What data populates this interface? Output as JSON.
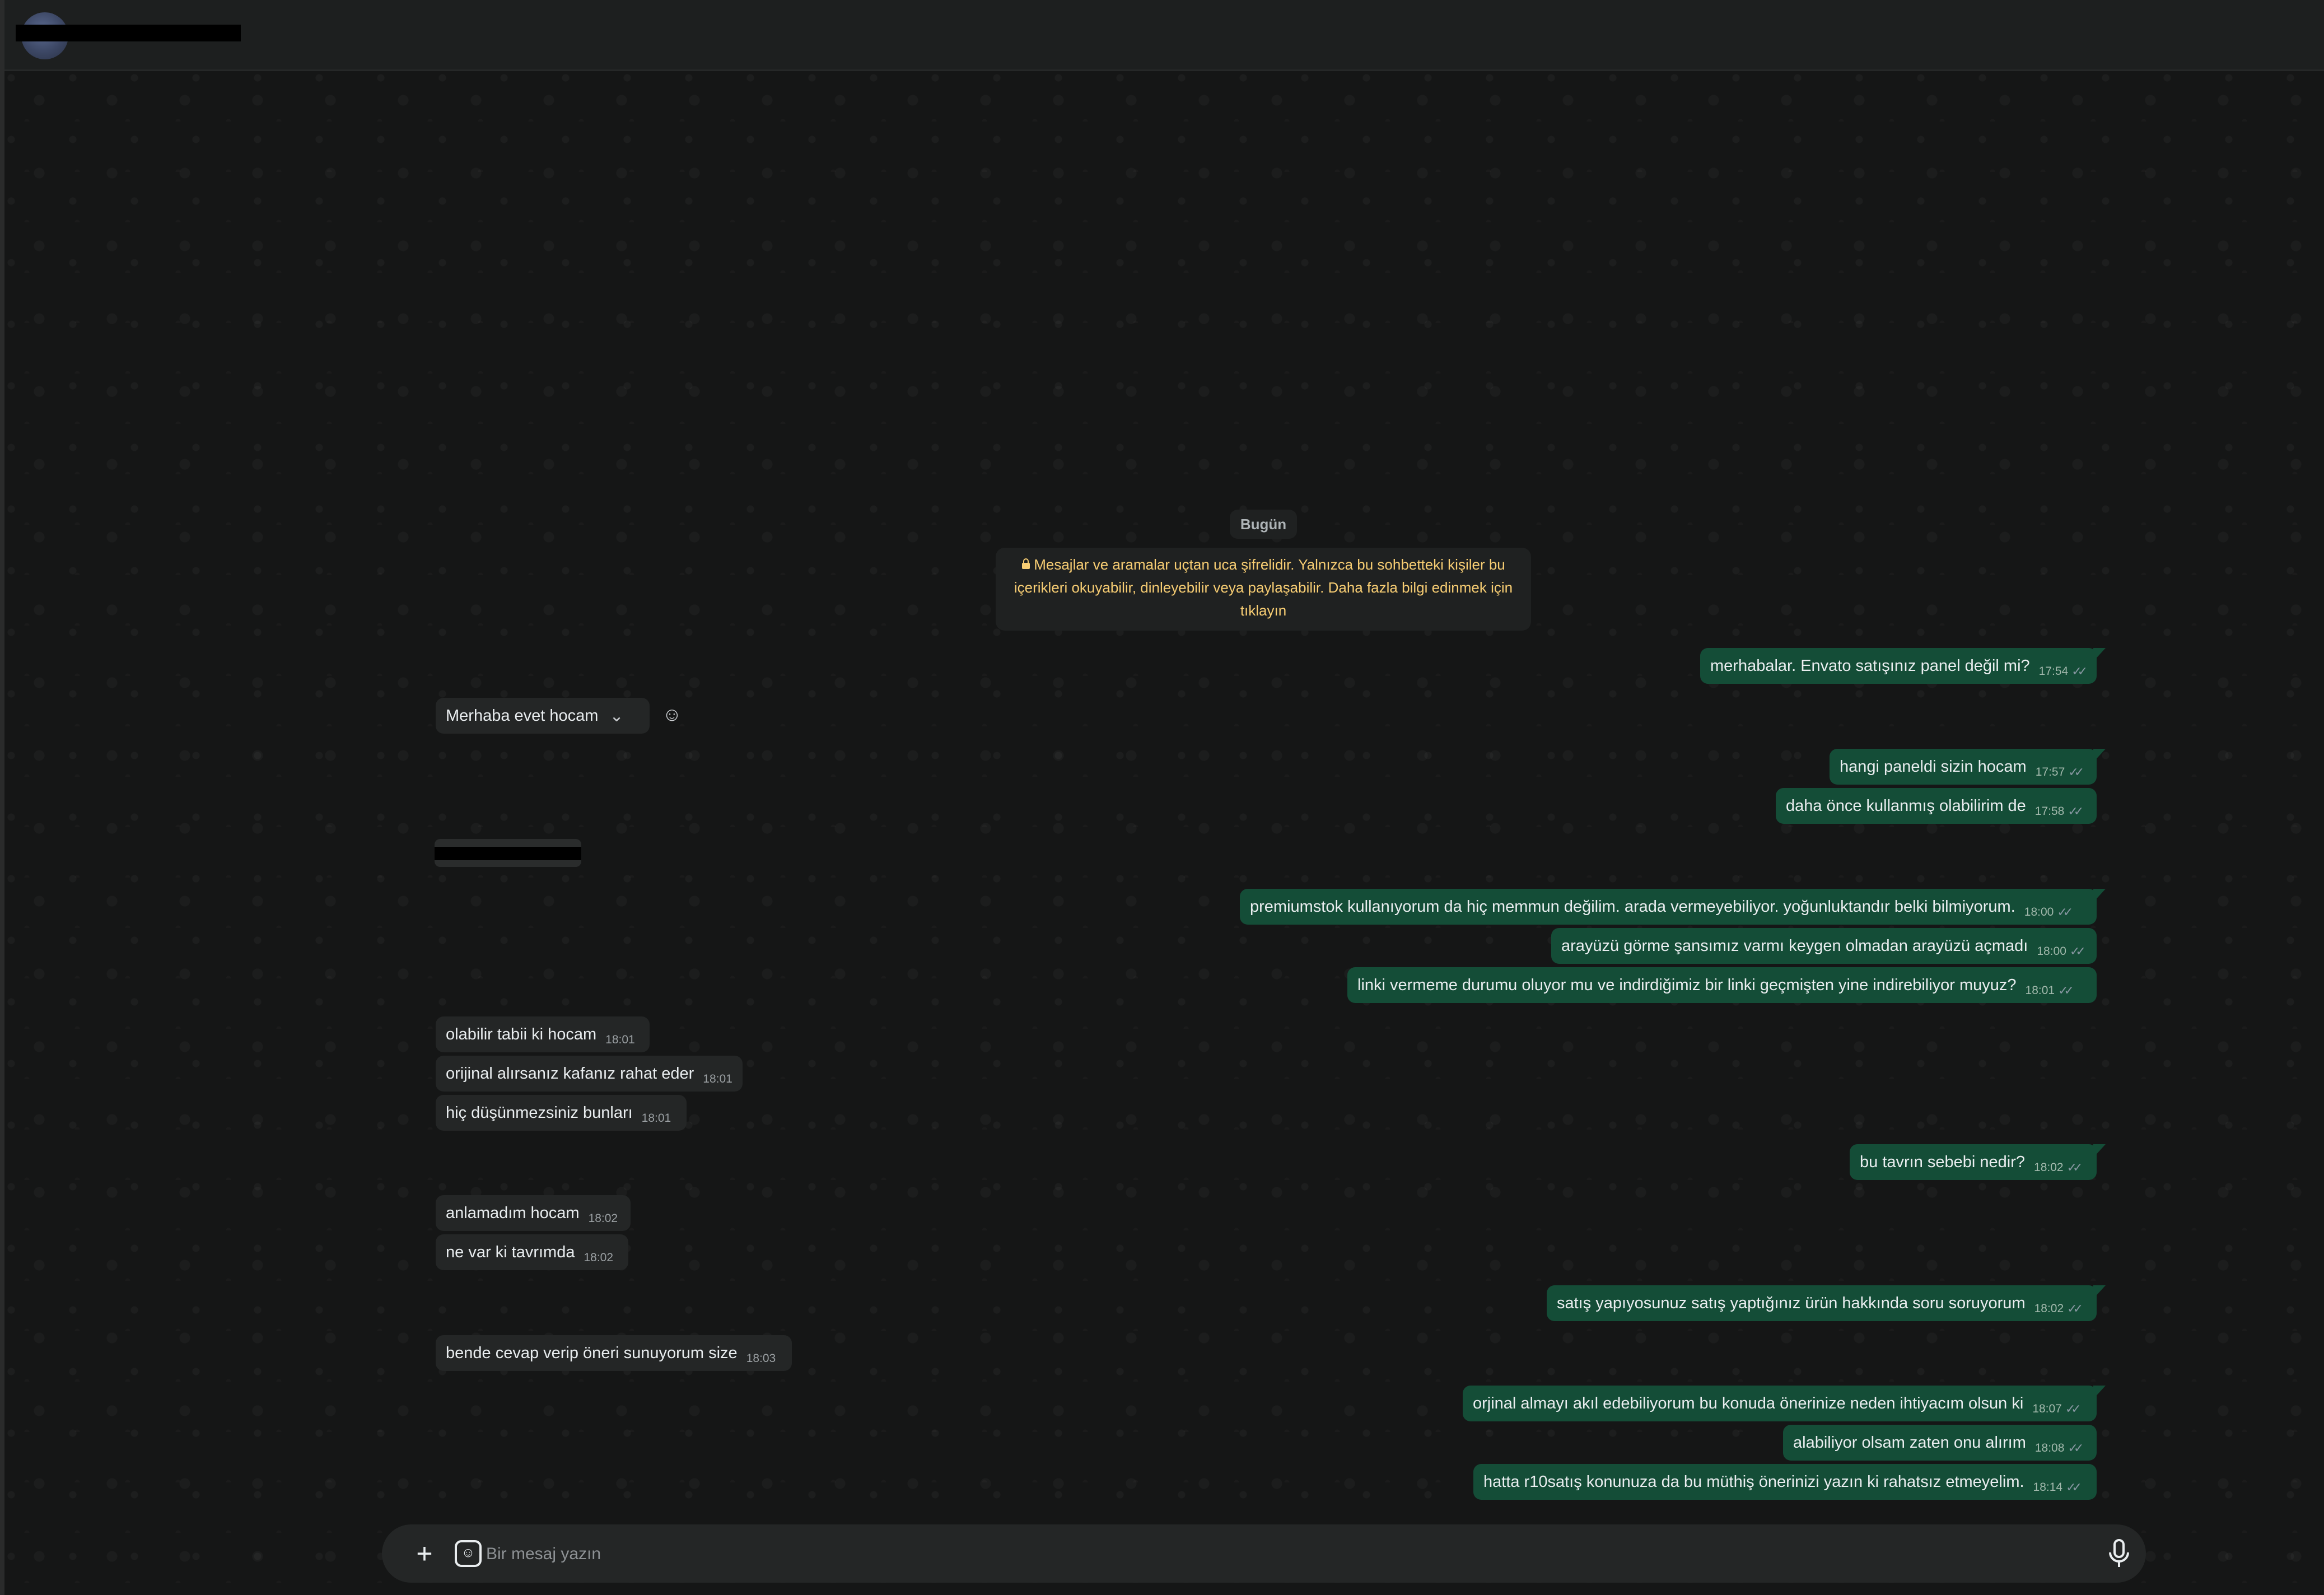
{
  "header": {
    "contact_name": ""
  },
  "chat": {
    "date_label": "Bugün",
    "encryption_notice": "Mesajlar ve aramalar uçtan uca şifrelidir. Yalnızca bu sohbetteki kişiler bu içerikleri okuyabilir, dinleyebilir veya paylaşabilir. Daha fazla bilgi edinmek için tıklayın",
    "messages": [
      {
        "dir": "out",
        "text": "merhabalar. Envato satışınız panel değil mi?",
        "time": "17:54"
      },
      {
        "dir": "in",
        "text": "Merhaba evet hocam",
        "time": ""
      },
      {
        "dir": "out",
        "text": "hangi paneldi sizin hocam",
        "time": "17:57"
      },
      {
        "dir": "out",
        "text": "daha önce kullanmış olabilirim de",
        "time": "17:58"
      },
      {
        "dir": "out",
        "text": "premiumstok kullanıyorum da hiç memmun değilim. arada vermeyebiliyor. yoğunluktandır belki bilmiyorum.",
        "time": "18:00"
      },
      {
        "dir": "out",
        "text": "arayüzü görme şansımız varmı keygen olmadan arayüzü açmadı",
        "time": "18:00"
      },
      {
        "dir": "out",
        "text": "linki vermeme durumu oluyor mu ve indirdiğimiz bir linki geçmişten yine indirebiliyor muyuz?",
        "time": "18:01"
      },
      {
        "dir": "in",
        "text": "olabilir tabii ki hocam",
        "time": "18:01"
      },
      {
        "dir": "in",
        "text": "orijinal alırsanız kafanız rahat eder",
        "time": "18:01"
      },
      {
        "dir": "in",
        "text": "hiç düşünmezsiniz bunları",
        "time": "18:01"
      },
      {
        "dir": "out",
        "text": "bu tavrın sebebi nedir?",
        "time": "18:02"
      },
      {
        "dir": "in",
        "text": "anlamadım hocam",
        "time": "18:02"
      },
      {
        "dir": "in",
        "text": "ne var ki tavrımda",
        "time": "18:02"
      },
      {
        "dir": "out",
        "text": "satış yapıyosunuz satış yaptığınız ürün hakkında soru soruyorum",
        "time": "18:02"
      },
      {
        "dir": "in",
        "text": "bende cevap verip öneri sunuyorum size",
        "time": "18:03"
      },
      {
        "dir": "out",
        "text": "orjinal almayı akıl edebiliyorum bu konuda önerinize neden ihtiyacım olsun ki",
        "time": "18:07"
      },
      {
        "dir": "out",
        "text": "alabiliyor olsam zaten onu alırım",
        "time": "18:08"
      },
      {
        "dir": "out",
        "text": "hatta r10satış konunuza da bu müthiş önerinizi yazın ki rahatsız etmeyelim.",
        "time": "18:14"
      }
    ]
  },
  "composer": {
    "placeholder": "Bir mesaj yazın"
  },
  "icons": {
    "attach": "plus-icon",
    "sticker": "sticker-icon",
    "voice": "mic-icon",
    "read_receipt": "double-check-icon",
    "lock": "lock-icon"
  },
  "colors": {
    "outgoing_bubble": "#144d37",
    "incoming_bubble": "#242626",
    "notice_text": "#f7cd73",
    "background": "#161717"
  }
}
